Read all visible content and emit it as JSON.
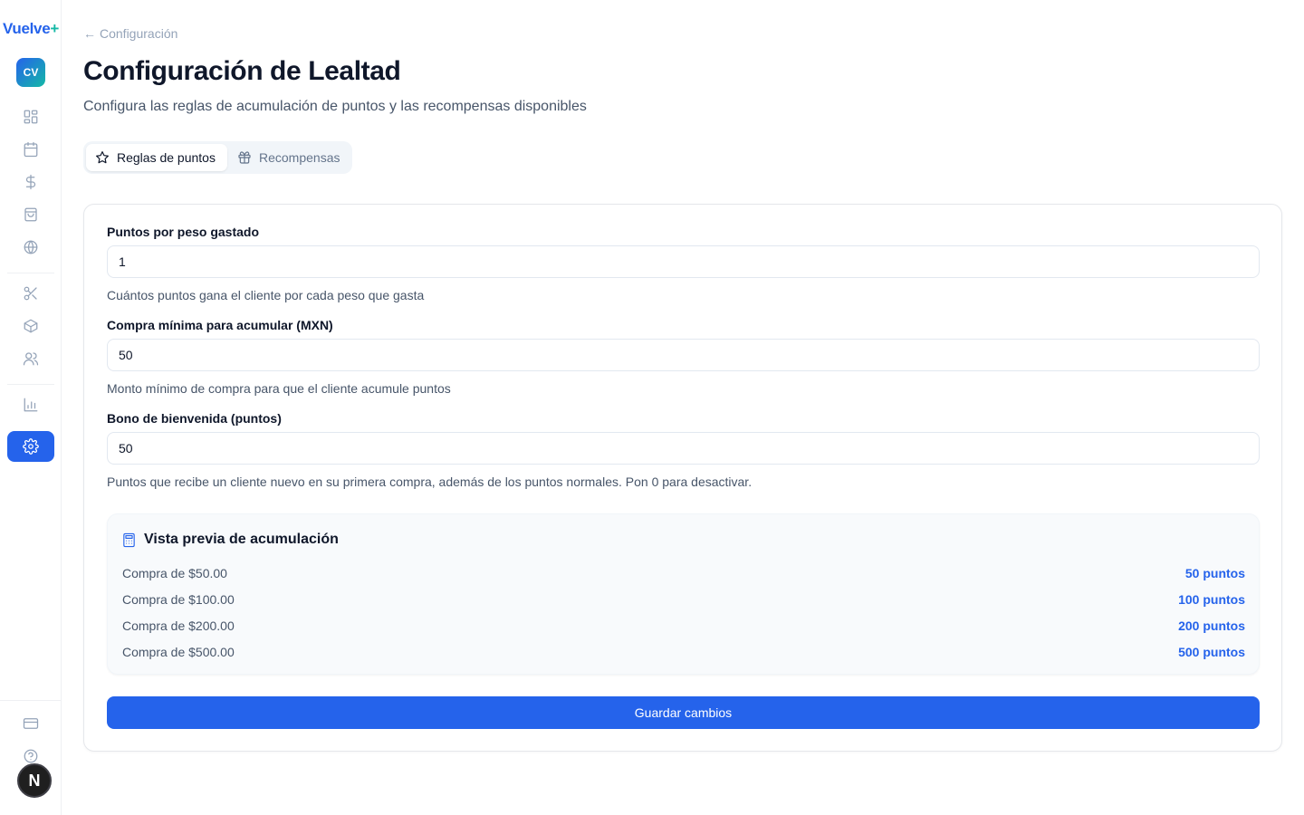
{
  "brand": {
    "name": "Vuelve",
    "plus": "+"
  },
  "org_avatar": "CV",
  "nav": {
    "items": [
      "dashboard",
      "calendar",
      "sales",
      "shopping-bag",
      "globe",
      "scissors",
      "box",
      "users",
      "analytics",
      "settings"
    ],
    "active": "settings"
  },
  "back_link": "Configuración",
  "page": {
    "title": "Configuración de Lealtad",
    "subtitle": "Configura las reglas de acumulación de puntos y las recompensas disponibles"
  },
  "tabs": [
    {
      "label": "Reglas de puntos",
      "icon": "star-icon",
      "active": true
    },
    {
      "label": "Recompensas",
      "icon": "gift-icon",
      "active": false
    }
  ],
  "form": {
    "points_per_peso": {
      "label": "Puntos por peso gastado",
      "value": "1",
      "help": "Cuántos puntos gana el cliente por cada peso que gasta"
    },
    "min_purchase": {
      "label": "Compra mínima para acumular (MXN)",
      "value": "50",
      "help": "Monto mínimo de compra para que el cliente acumule puntos"
    },
    "welcome_bonus": {
      "label": "Bono de bienvenida (puntos)",
      "value": "50",
      "help": "Puntos que recibe un cliente nuevo en su primera compra, además de los puntos normales. Pon 0 para desactivar."
    }
  },
  "preview": {
    "title": "Vista previa de acumulación",
    "rows": [
      {
        "label": "Compra de $50.00",
        "value": "50 puntos"
      },
      {
        "label": "Compra de $100.00",
        "value": "100 puntos"
      },
      {
        "label": "Compra de $200.00",
        "value": "200 puntos"
      },
      {
        "label": "Compra de $500.00",
        "value": "500 puntos"
      }
    ]
  },
  "save_label": "Guardar cambios",
  "user_badge": "N",
  "colors": {
    "accent": "#2563eb",
    "teal": "#14b8a6"
  }
}
